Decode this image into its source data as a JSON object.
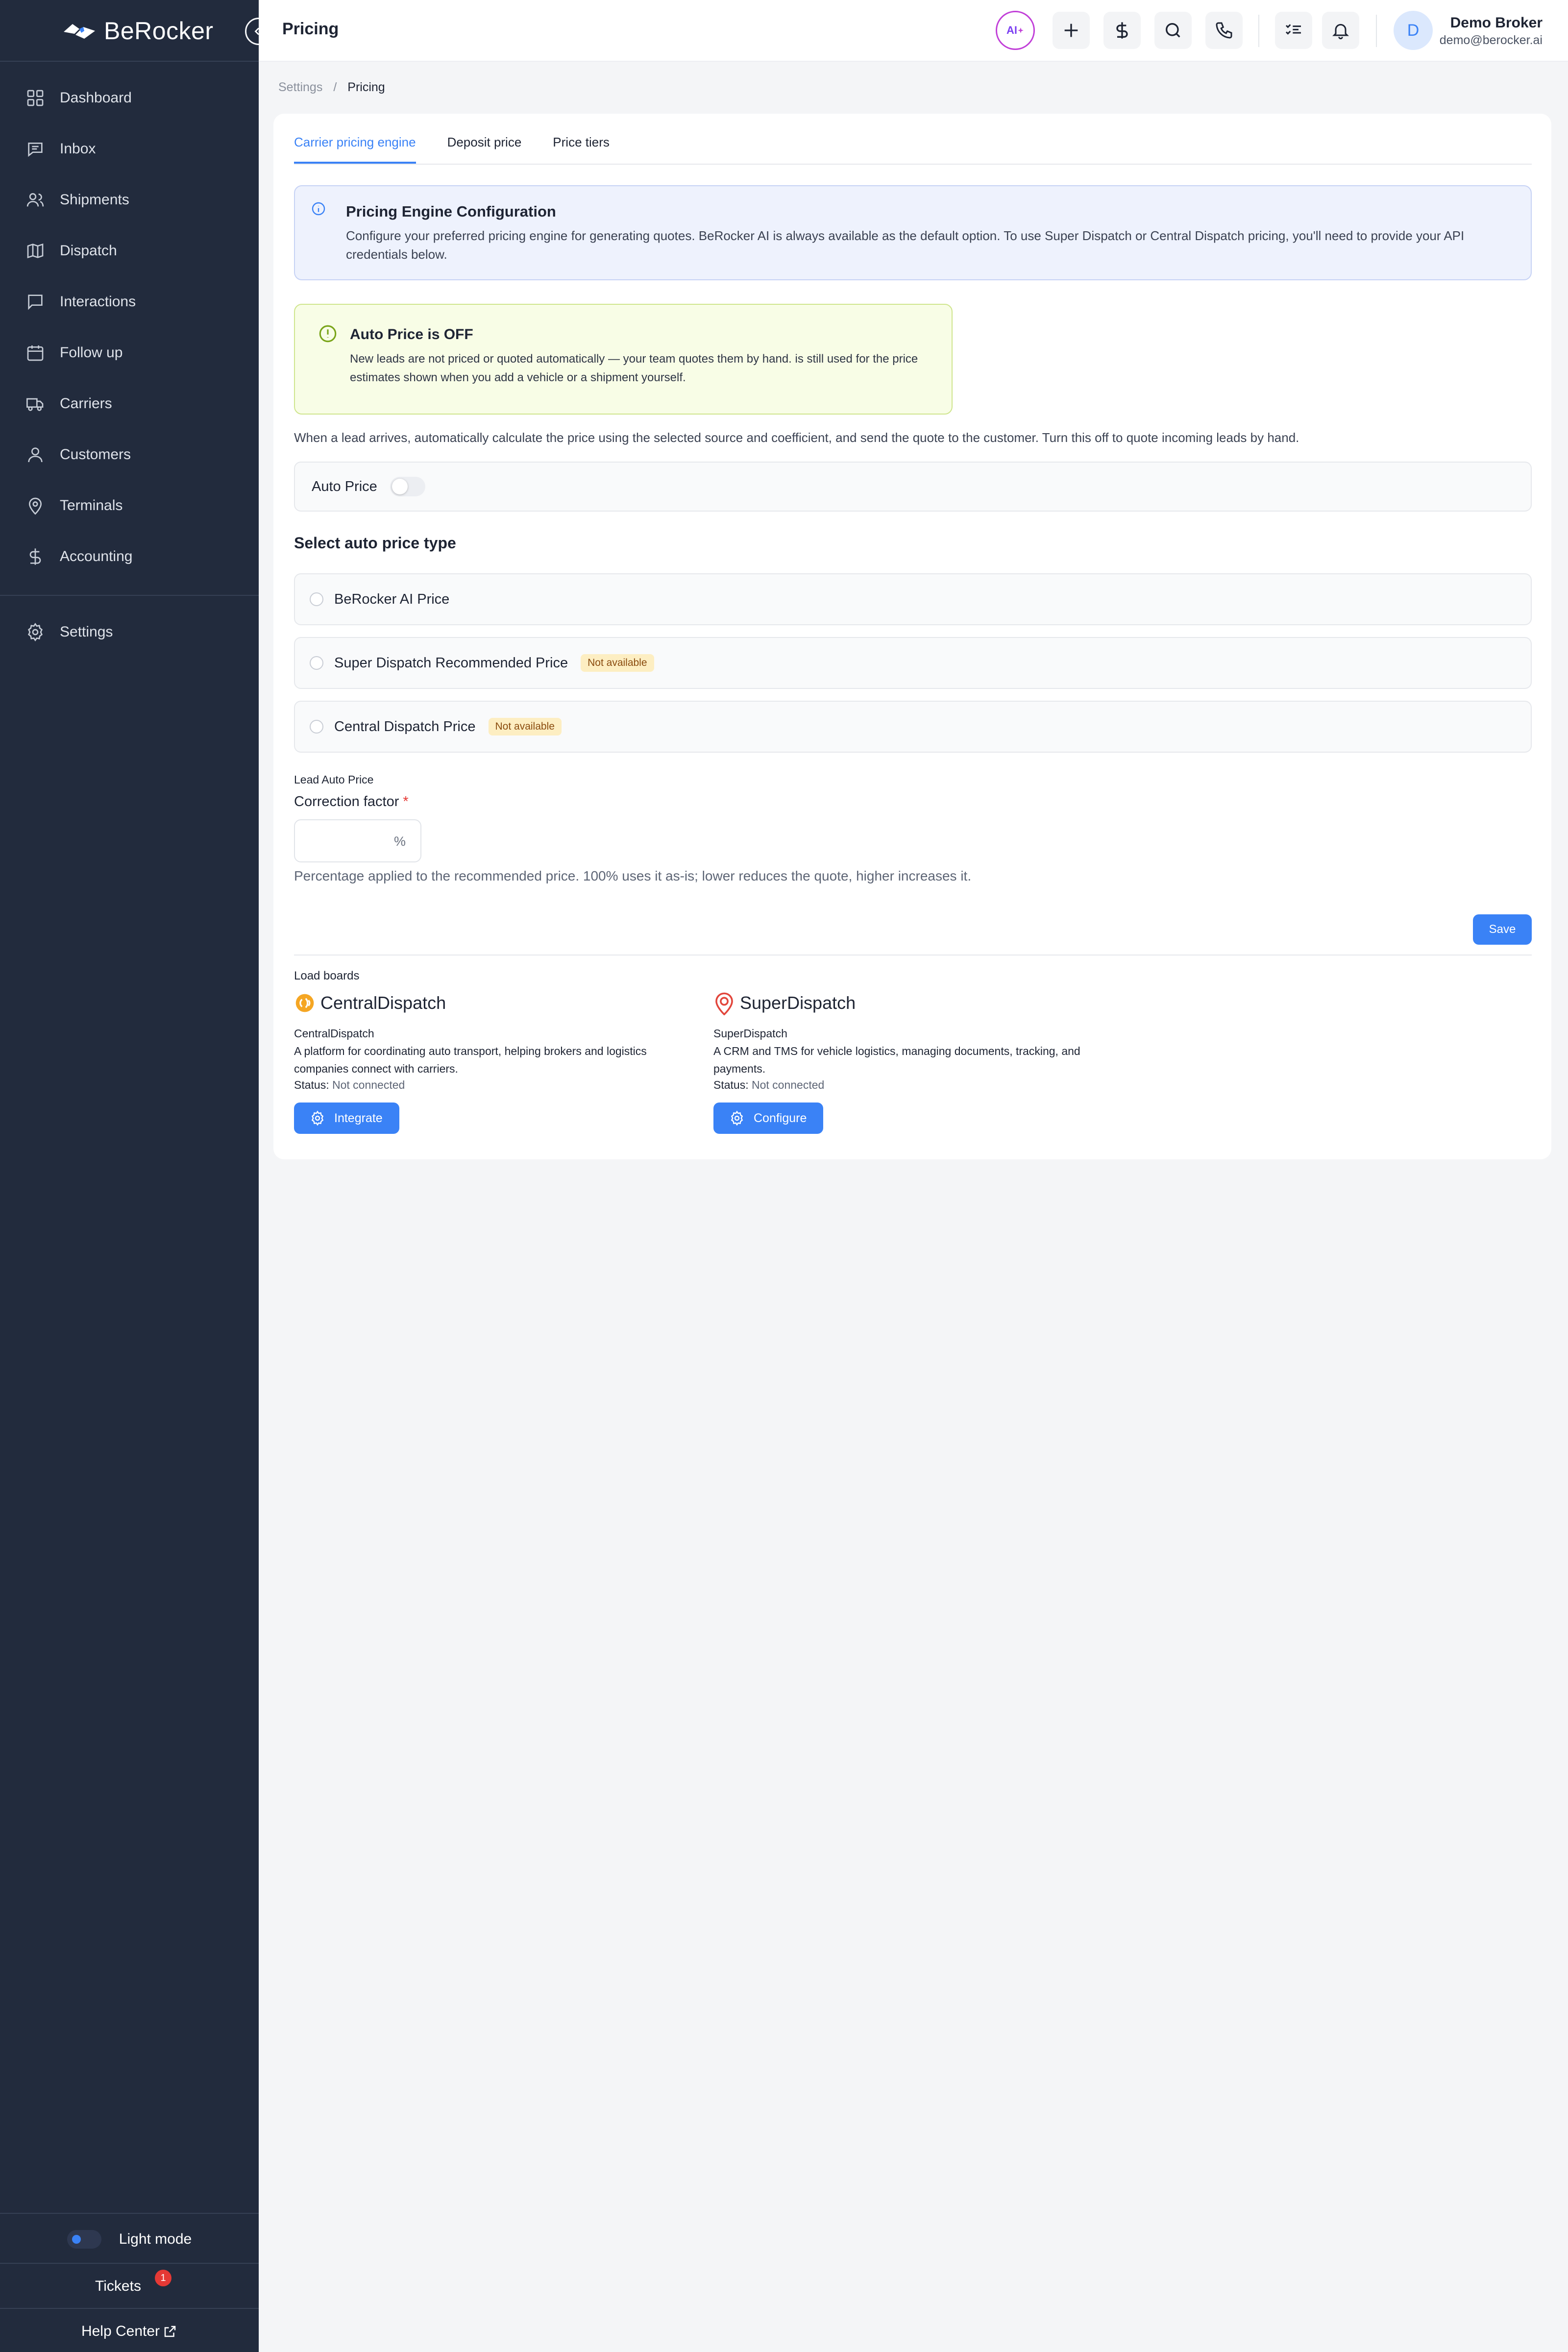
{
  "app": {
    "brand": "BeRocker"
  },
  "sidebar": {
    "items": [
      {
        "label": "Dashboard",
        "icon": "grid-icon"
      },
      {
        "label": "Inbox",
        "icon": "inbox-icon"
      },
      {
        "label": "Shipments",
        "icon": "users-icon"
      },
      {
        "label": "Dispatch",
        "icon": "map-icon"
      },
      {
        "label": "Interactions",
        "icon": "chat-icon"
      },
      {
        "label": "Follow up",
        "icon": "calendar-icon"
      },
      {
        "label": "Carriers",
        "icon": "truck-icon"
      },
      {
        "label": "Customers",
        "icon": "user-icon"
      },
      {
        "label": "Terminals",
        "icon": "pin-icon"
      },
      {
        "label": "Accounting",
        "icon": "dollar-icon"
      }
    ],
    "settings_label": "Settings",
    "light_mode_label": "Light mode",
    "tickets_label": "Tickets",
    "tickets_count": "1",
    "help_label": "Help Center"
  },
  "header": {
    "title": "Pricing",
    "ai_label": "AI",
    "user_name": "Demo Broker",
    "user_email": "demo@berocker.ai",
    "avatar_initial": "D"
  },
  "breadcrumb": {
    "parent": "Settings",
    "separator": "/",
    "current": "Pricing"
  },
  "tabs": [
    {
      "label": "Carrier pricing engine",
      "active": true
    },
    {
      "label": "Deposit price",
      "active": false
    },
    {
      "label": "Price tiers",
      "active": false
    }
  ],
  "info_box": {
    "title": "Pricing Engine Configuration",
    "text": "Configure your preferred pricing engine for generating quotes. BeRocker AI is always available as the default option. To use Super Dispatch or Central Dispatch pricing, you'll need to provide your API credentials below."
  },
  "warning_box": {
    "title": "Auto Price is OFF",
    "text": "New leads are not priced or quoted automatically — your team quotes them by hand. is still used for the price estimates shown when you add a vehicle or a shipment yourself."
  },
  "auto_price": {
    "description": "When a lead arrives, automatically calculate the price using the selected source and coefficient, and send the quote to the customer. Turn this off to quote incoming leads by hand.",
    "label": "Auto Price",
    "enabled": false
  },
  "price_type": {
    "heading": "Select auto price type",
    "options": [
      {
        "label": "BeRocker AI Price",
        "badge": ""
      },
      {
        "label": "Super Dispatch Recommended Price",
        "badge": "Not available"
      },
      {
        "label": "Central Dispatch Price",
        "badge": "Not available"
      }
    ]
  },
  "correction": {
    "section_label": "Lead Auto Price",
    "field_label": "Correction factor",
    "required_mark": "*",
    "value": "",
    "suffix": "%",
    "help": "Percentage applied to the recommended price. 100% uses it as-is; lower reduces the quote, higher increases it."
  },
  "save_label": "Save",
  "load_boards": {
    "title": "Load boards",
    "boards": [
      {
        "logo_text": "CentralDispatch",
        "name": "CentralDispatch",
        "description": "A platform for coordinating auto transport, helping brokers and logistics companies connect with carriers.",
        "status_label": "Status:",
        "status": "Not connected",
        "button": "Integrate"
      },
      {
        "logo_text": "SuperDispatch",
        "name": "SuperDispatch",
        "description": "A CRM and TMS for vehicle logistics, managing documents, tracking, and payments.",
        "status_label": "Status:",
        "status": "Not connected",
        "button": "Configure"
      }
    ]
  },
  "colors": {
    "sidebar_bg": "#222b3d",
    "accent": "#3a82f6",
    "info_bg": "#eef2fd",
    "warning_bg": "#f8fde6",
    "badge_bg": "#fdeec2"
  }
}
